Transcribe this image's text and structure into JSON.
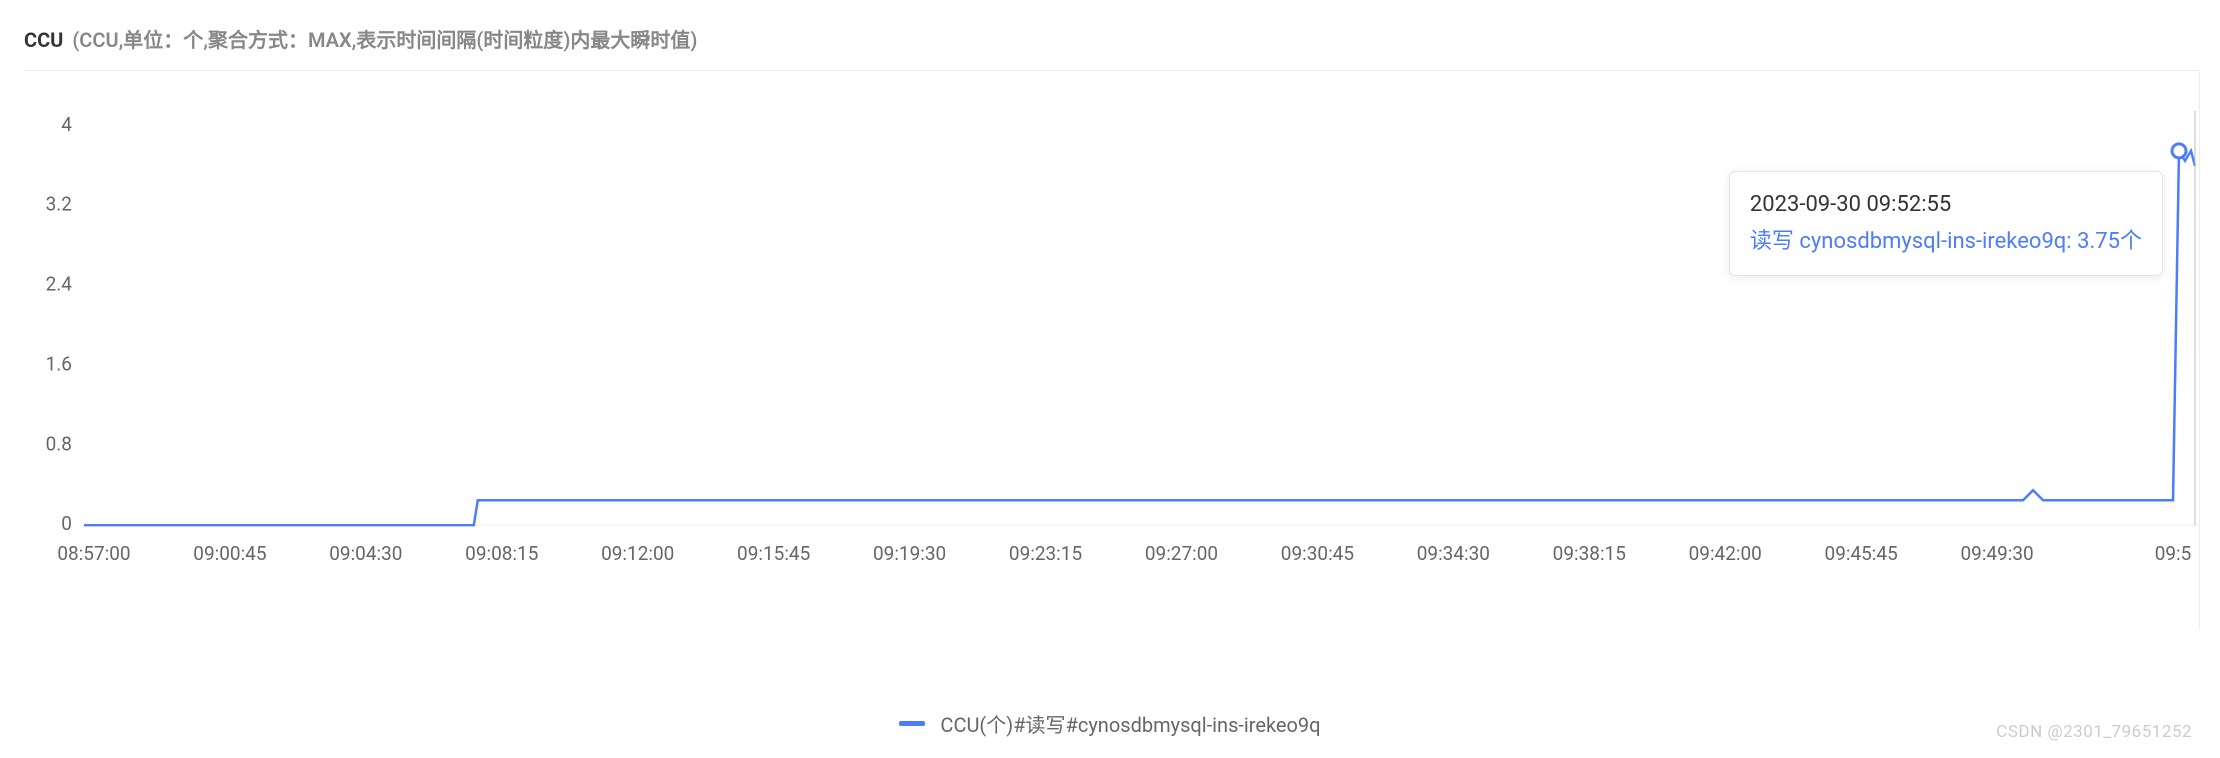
{
  "title": {
    "bold": "CCU",
    "desc": "(CCU,单位：个,聚合方式：MAX,表示时间间隔(时间粒度)内最大瞬时值)"
  },
  "chart_data": {
    "type": "line",
    "title": "CCU (CCU,单位：个,聚合方式：MAX,表示时间间隔(时间粒度)内最大瞬时值)",
    "xlabel": "",
    "ylabel": "",
    "ylim": [
      0,
      4
    ],
    "y_ticks": [
      0,
      0.8,
      1.6,
      2.4,
      3.2,
      4
    ],
    "x_ticks": [
      "08:57:00",
      "09:00:45",
      "09:04:30",
      "09:08:15",
      "09:12:00",
      "09:15:45",
      "09:19:30",
      "09:23:15",
      "09:27:00",
      "09:30:45",
      "09:34:30",
      "09:38:15",
      "09:42:00",
      "09:45:45",
      "09:49:30",
      "09:5"
    ],
    "series": [
      {
        "name": "CCU(个)#读写#cynosdbmysql-ins-irekeo9q",
        "color": "#4d7cfe",
        "x": [
          "08:57:00",
          "08:58:00",
          "08:59:00",
          "09:00:00",
          "09:01:00",
          "09:02:00",
          "09:03:00",
          "09:04:00",
          "09:05:00",
          "09:06:00",
          "09:07:00",
          "09:07:30",
          "09:08:00",
          "09:09:00",
          "09:10:00",
          "09:12:00",
          "09:15:00",
          "09:18:00",
          "09:21:00",
          "09:24:00",
          "09:27:00",
          "09:30:00",
          "09:33:00",
          "09:36:00",
          "09:39:00",
          "09:42:00",
          "09:45:00",
          "09:48:00",
          "09:49:00",
          "09:49:20",
          "09:49:40",
          "09:50:00",
          "09:51:00",
          "09:52:00",
          "09:52:30",
          "09:52:55"
        ],
        "values": [
          0,
          0,
          0,
          0,
          0,
          0,
          0,
          0,
          0,
          0,
          0,
          0,
          0.25,
          0.25,
          0.25,
          0.25,
          0.25,
          0.25,
          0.25,
          0.25,
          0.25,
          0.25,
          0.25,
          0.25,
          0.25,
          0.25,
          0.25,
          0.25,
          0.25,
          0.35,
          0.25,
          0.25,
          0.25,
          0.25,
          0.25,
          3.75
        ]
      }
    ],
    "tooltip_point": {
      "timestamp": "2023-09-30 09:52:55",
      "label": "读写 cynosdbmysql-ins-irekeo9q",
      "value": 3.75,
      "unit": "个"
    }
  },
  "tooltip": {
    "timestamp": "2023-09-30 09:52:55",
    "value_line": "读写 cynosdbmysql-ins-irekeo9q: 3.75个"
  },
  "legend": {
    "label": "CCU(个)#读写#cynosdbmysql-ins-irekeo9q"
  },
  "watermark": "CSDN @2301_79651252"
}
